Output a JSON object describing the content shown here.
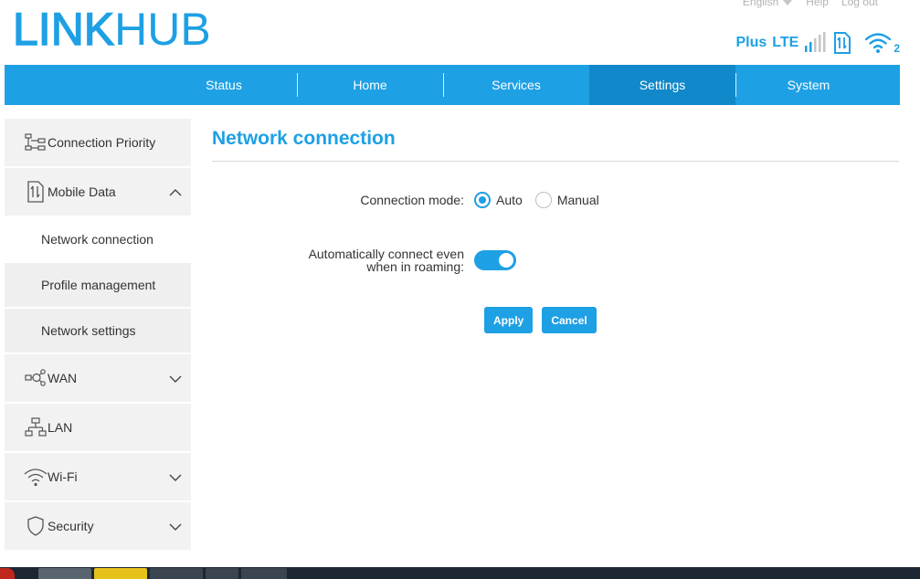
{
  "brand": {
    "bold": "LINK",
    "thin": "HUB"
  },
  "toplinks": {
    "language": "English",
    "help": "Help",
    "logout": "Log out"
  },
  "status": {
    "operator": "Plus",
    "network": "LTE",
    "wifi_clients": "2"
  },
  "nav": {
    "tabs": [
      {
        "label": "Status"
      },
      {
        "label": "Home"
      },
      {
        "label": "Services"
      },
      {
        "label": "Settings",
        "active": true
      },
      {
        "label": "System"
      }
    ]
  },
  "sidebar": {
    "connection_priority": "Connection Priority",
    "mobile_data": "Mobile Data",
    "sub": {
      "network_connection": "Network connection",
      "profile_management": "Profile management",
      "network_settings": "Network settings"
    },
    "wan": "WAN",
    "lan": "LAN",
    "wifi": "Wi-Fi",
    "security": "Security"
  },
  "main": {
    "title": "Network connection",
    "connection_mode_label": "Connection mode:",
    "options": {
      "auto": "Auto",
      "manual": "Manual"
    },
    "selected_mode": "Auto",
    "roaming_label_line1": "Automatically connect even",
    "roaming_label_line2": "when in roaming:",
    "roaming_enabled": true,
    "apply": "Apply",
    "cancel": "Cancel"
  },
  "colors": {
    "accent": "#1ea0e4",
    "accent_dark": "#1188c9",
    "sidebar_bg": "#f2f2f2",
    "taskbar": "#1d2733"
  }
}
